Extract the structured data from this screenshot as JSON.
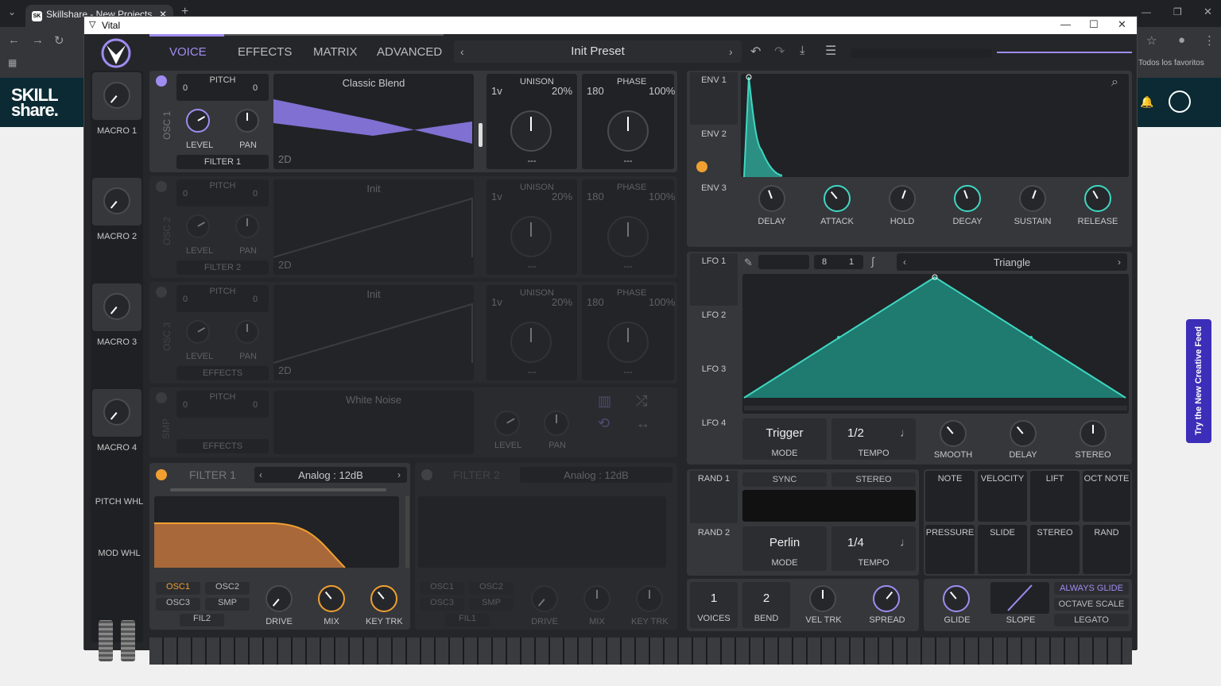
{
  "browser": {
    "tab_title": "Skillshare - New Projects",
    "favorites": "Todos los favoritos"
  },
  "site": {
    "logo_l1": "SKILL",
    "logo_l2": "share.",
    "cta": "Try the New Creative Feed"
  },
  "window": {
    "title": "Vital"
  },
  "nav": {
    "tabs": [
      "VOICE",
      "EFFECTS",
      "MATRIX",
      "ADVANCED"
    ],
    "preset": "Init Preset"
  },
  "macros": [
    "MACRO 1",
    "MACRO 2",
    "MACRO 3",
    "MACRO 4"
  ],
  "side": {
    "pitch": "PITCH WHL",
    "mod": "MOD WHL"
  },
  "osc": [
    {
      "label": "OSC 1",
      "pitch_l": "0",
      "pitch_r": "0",
      "pitch": "PITCH",
      "wave": "Classic Blend",
      "dim": "2D",
      "level": "LEVEL",
      "pan": "PAN",
      "route": "FILTER 1",
      "unison": "UNISON",
      "voices": "1v",
      "detune": "20%",
      "phase": "PHASE",
      "phase_v": "180",
      "phase_r": "100%",
      "sel1": "---",
      "sel2": "---"
    },
    {
      "label": "OSC 2",
      "pitch_l": "0",
      "pitch_r": "0",
      "pitch": "PITCH",
      "wave": "Init",
      "dim": "2D",
      "level": "LEVEL",
      "pan": "PAN",
      "route": "FILTER 2",
      "unison": "UNISON",
      "voices": "1v",
      "detune": "20%",
      "phase": "PHASE",
      "phase_v": "180",
      "phase_r": "100%",
      "sel1": "---",
      "sel2": "---"
    },
    {
      "label": "OSC 3",
      "pitch_l": "0",
      "pitch_r": "0",
      "pitch": "PITCH",
      "wave": "Init",
      "dim": "2D",
      "level": "LEVEL",
      "pan": "PAN",
      "route": "EFFECTS",
      "unison": "UNISON",
      "voices": "1v",
      "detune": "20%",
      "phase": "PHASE",
      "phase_v": "180",
      "phase_r": "100%",
      "sel1": "---",
      "sel2": "---"
    }
  ],
  "smp": {
    "label": "SMP",
    "pitch": "PITCH",
    "pitch_l": "0",
    "pitch_r": "0",
    "wave": "White Noise",
    "route": "EFFECTS",
    "level": "LEVEL",
    "pan": "PAN"
  },
  "filter1": {
    "title": "FILTER 1",
    "type": "Analog : 12dB",
    "b": [
      "OSC1",
      "OSC2",
      "OSC3",
      "SMP",
      "FIL2"
    ],
    "k": [
      "DRIVE",
      "MIX",
      "KEY TRK"
    ]
  },
  "filter2": {
    "title": "FILTER 2",
    "type": "Analog : 12dB",
    "b": [
      "OSC1",
      "OSC2",
      "OSC3",
      "SMP",
      "FIL1"
    ],
    "k": [
      "DRIVE",
      "MIX",
      "KEY TRK"
    ]
  },
  "env": {
    "tabs": [
      "ENV 1",
      "ENV 2",
      "ENV 3"
    ],
    "k": [
      "DELAY",
      "ATTACK",
      "HOLD",
      "DECAY",
      "SUSTAIN",
      "RELEASE"
    ]
  },
  "lfo": {
    "tabs": [
      "LFO 1",
      "LFO 2",
      "LFO 3",
      "LFO 4"
    ],
    "shape": "Triangle",
    "num": "8",
    "den": "1",
    "mode": "Trigger",
    "mode_l": "MODE",
    "tempo": "1/2",
    "tempo_l": "TEMPO",
    "k": [
      "SMOOTH",
      "DELAY",
      "STEREO"
    ]
  },
  "rand": {
    "tabs": [
      "RAND 1",
      "RAND 2"
    ],
    "sync": "SYNC",
    "stereo": "STEREO",
    "mode": "Perlin",
    "mode_l": "MODE",
    "tempo": "1/4",
    "tempo_l": "TEMPO"
  },
  "mods": [
    "NOTE",
    "VELOCITY",
    "LIFT",
    "OCT NOTE",
    "PRESSURE",
    "SLIDE",
    "STEREO",
    "RAND"
  ],
  "voice": {
    "voices": "1",
    "voices_l": "VOICES",
    "bend": "2",
    "bend_l": "BEND",
    "vel": "VEL TRK",
    "spread": "SPREAD",
    "glide": "GLIDE",
    "slope": "SLOPE",
    "o1": "ALWAYS GLIDE",
    "o2": "OCTAVE SCALE",
    "o3": "LEGATO"
  }
}
